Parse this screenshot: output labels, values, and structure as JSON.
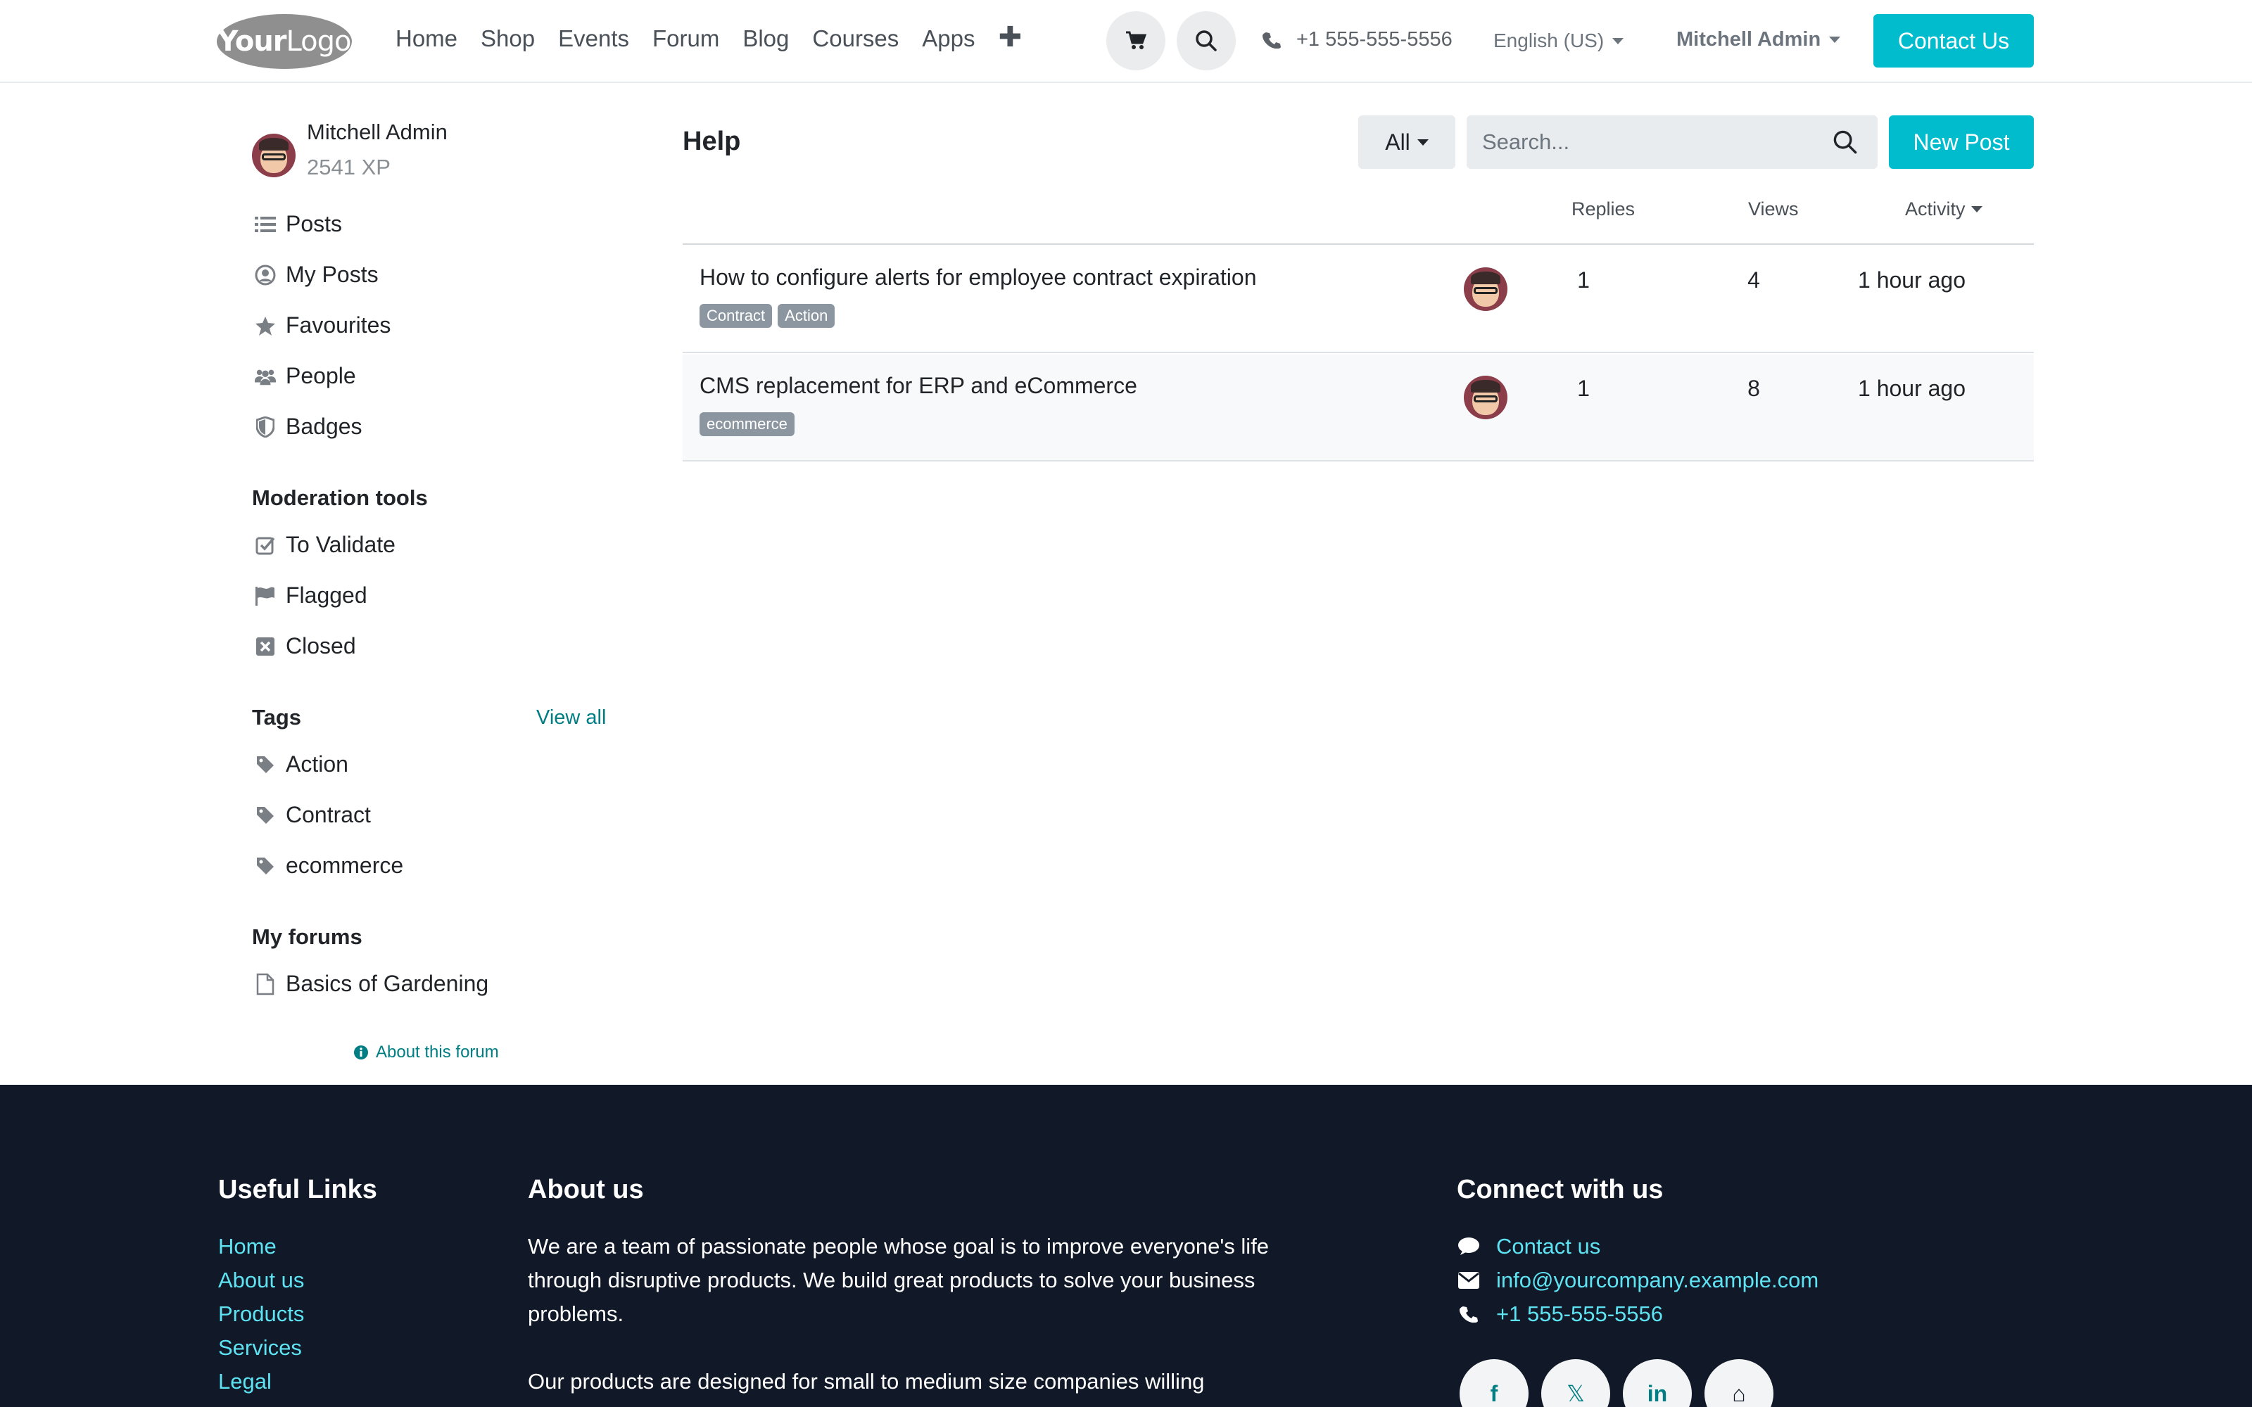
{
  "header": {
    "logo": {
      "part1": "Your",
      "part2": "Logo"
    },
    "nav": [
      "Home",
      "Shop",
      "Events",
      "Forum",
      "Blog",
      "Courses",
      "Apps"
    ],
    "plus_icon": "plus-icon",
    "phone": "+1 555-555-5556",
    "language": "English (US)",
    "user": "Mitchell Admin",
    "contact_button": "Contact Us"
  },
  "sidebar": {
    "user_name": "Mitchell Admin",
    "xp": "2541 XP",
    "items": [
      {
        "label": "Posts",
        "icon": "list-icon"
      },
      {
        "label": "My Posts",
        "icon": "user-circle-icon"
      },
      {
        "label": "Favourites",
        "icon": "star-icon"
      },
      {
        "label": "People",
        "icon": "users-icon"
      },
      {
        "label": "Badges",
        "icon": "shield-icon"
      }
    ],
    "moderation_title": "Moderation tools",
    "moderation_items": [
      {
        "label": "To Validate",
        "icon": "check-square-icon"
      },
      {
        "label": "Flagged",
        "icon": "flag-icon"
      },
      {
        "label": "Closed",
        "icon": "close-square-icon"
      }
    ],
    "tags_title": "Tags",
    "view_all": "View all",
    "tags": [
      "Action",
      "Contract",
      "ecommerce"
    ],
    "my_forums_title": "My forums",
    "my_forums": [
      "Basics of Gardening"
    ],
    "about_forum": "About this forum"
  },
  "main": {
    "title": "Help",
    "filter": "All",
    "search_placeholder": "Search...",
    "new_post": "New Post",
    "columns": {
      "replies": "Replies",
      "views": "Views",
      "activity": "Activity"
    },
    "posts": [
      {
        "title": "How to configure alerts for employee contract expiration",
        "tags": [
          "Contract",
          "Action"
        ],
        "replies": "1",
        "views": "4",
        "activity": "1 hour ago"
      },
      {
        "title": "CMS replacement for ERP and eCommerce",
        "tags": [
          "ecommerce"
        ],
        "replies": "1",
        "views": "8",
        "activity": "1 hour ago"
      }
    ]
  },
  "footer": {
    "useful_links_title": "Useful Links",
    "useful_links": [
      "Home",
      "About us",
      "Products",
      "Services",
      "Legal"
    ],
    "about_title": "About us",
    "about_p1": "We are a team of passionate people whose goal is to improve everyone's life through disruptive products. We build great products to solve your business problems.",
    "about_p2": "Our products are designed for small to medium size companies willing",
    "connect_title": "Connect with us",
    "contact_us": "Contact us",
    "email": "info@yourcompany.example.com",
    "phone": "+1 555-555-5556",
    "socials": [
      {
        "icon": "facebook-icon",
        "glyph": "f"
      },
      {
        "icon": "x-icon",
        "glyph": "𝕏"
      },
      {
        "icon": "linkedin-icon",
        "glyph": "in"
      },
      {
        "icon": "home-icon",
        "glyph": "⌂"
      }
    ]
  },
  "colors": {
    "accent": "#00bccd",
    "link": "#017e84",
    "footer_bg": "#111827",
    "footer_link": "#5ee3f3"
  }
}
